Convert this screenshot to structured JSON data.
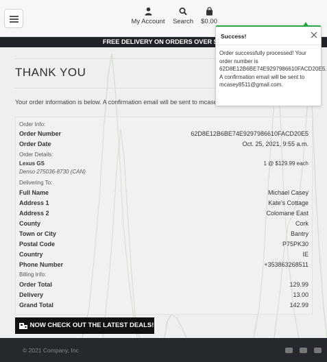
{
  "header": {
    "account_label": "My Account",
    "search_label": "Search",
    "bag_total": "$0.00"
  },
  "banner": {
    "text": "FREE DELIVERY ON ORDERS OVER $15"
  },
  "page": {
    "title": "THANK YOU",
    "intro": "Your order information is below. A confirmation email will be sent to mcasey8511@gmail.com."
  },
  "order": {
    "info_heading": "Order Info:",
    "number_label": "Order Number",
    "number_value": "62D8E12B6BE74E9297986610FACD20E5",
    "date_label": "Order Date",
    "date_value": "Oct. 25, 2021, 9:55 a.m.",
    "details_heading": "Order Details:",
    "item_name": "Lexus GS",
    "item_sku": "Denso 275036-8730 (CAN)",
    "item_qty": "1 @ $129.99 each",
    "delivery_heading": "Delivering To:",
    "delivery_rows": [
      {
        "label": "Full Name",
        "value": "Michael Casey"
      },
      {
        "label": "Address 1",
        "value": "Kate's Cottage"
      },
      {
        "label": "Address 2",
        "value": "Colomane East"
      },
      {
        "label": "County",
        "value": "Cork"
      },
      {
        "label": "Town or City",
        "value": "Bantry"
      },
      {
        "label": "Postal Code",
        "value": "P75PK30"
      },
      {
        "label": "Country",
        "value": "IE"
      },
      {
        "label": "Phone Number",
        "value": "+353863268511"
      }
    ],
    "billing_heading": "Billing Info:",
    "billing_rows": [
      {
        "label": "Order Total",
        "value": "129.99"
      },
      {
        "label": "Delivery",
        "value": "13.00"
      },
      {
        "label": "Grand Total",
        "value": "142.99"
      }
    ]
  },
  "cta": {
    "label": "NOW CHECK OUT THE LATEST DEALS!"
  },
  "footer": {
    "copyright": "© 2021 Company, Inc",
    "social_icons": [
      "instagram-icon",
      "youtube-icon",
      "youtube-icon"
    ]
  },
  "toast": {
    "title": "Success!",
    "message": "Order successfully processed! Your order number is 62D8E12B6BE74E9297986610FACD20E5. A confirmation email will be sent to mcasey8511@gmail.com.",
    "accent_color": "#28a745"
  }
}
